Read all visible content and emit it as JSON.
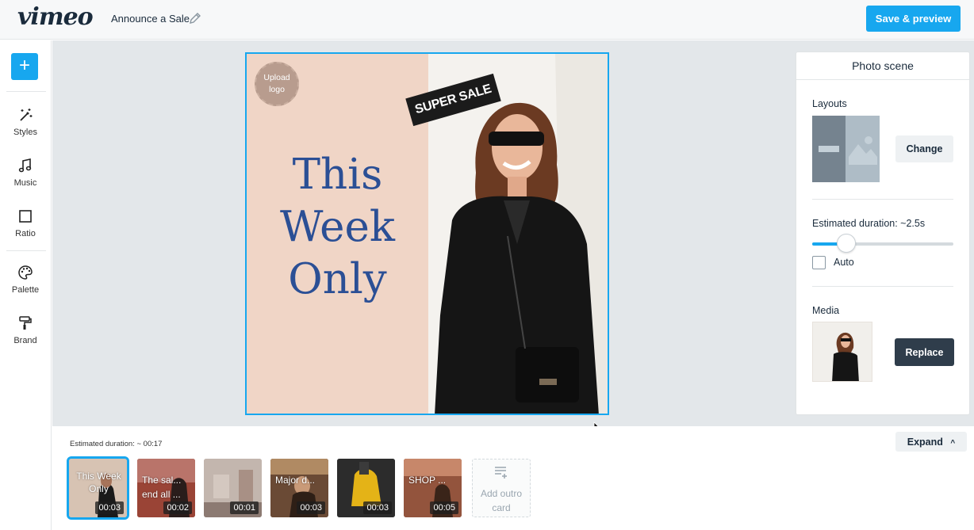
{
  "header": {
    "logo": "vimeo",
    "project_title": "Announce a Sale",
    "save_label": "Save & preview",
    "accent": "#17a7ef"
  },
  "sidebar": {
    "add_label": "+",
    "items": [
      {
        "label": "Styles",
        "icon": "magic-wand-icon"
      },
      {
        "label": "Music",
        "icon": "music-note-icon"
      },
      {
        "label": "Ratio",
        "icon": "square-icon"
      },
      {
        "label": "Palette",
        "icon": "palette-icon"
      },
      {
        "label": "Brand",
        "icon": "paint-roller-icon"
      }
    ]
  },
  "scene": {
    "upload_logo": "Upload logo",
    "headline": [
      "This",
      "Week",
      "Only"
    ],
    "sale_flag": "SUPER SALE",
    "left_bg": "#f0d5c6",
    "text_color": "#2b4f95"
  },
  "panel": {
    "title": "Photo scene",
    "layouts_label": "Layouts",
    "change_label": "Change",
    "duration_label": "Estimated duration: ~2.5s",
    "duration_slider_fraction": 0.24,
    "auto_label": "Auto",
    "auto_checked": false,
    "media_label": "Media",
    "replace_label": "Replace"
  },
  "timeline": {
    "estimated_label": "Estimated duration: ~ 00:17",
    "expand_label": "Expand",
    "clips": [
      {
        "text": "This Week Only",
        "time": "00:03",
        "active": true
      },
      {
        "text": "The sal... end all ...",
        "time": "00:02",
        "active": false
      },
      {
        "text": "",
        "time": "00:01",
        "active": false
      },
      {
        "text": "Major d...",
        "time": "00:03",
        "active": false
      },
      {
        "text": "",
        "time": "00:03",
        "active": false
      },
      {
        "text": "SHOP ...",
        "time": "00:05",
        "active": false
      }
    ],
    "outro_label": "Add outro card"
  }
}
